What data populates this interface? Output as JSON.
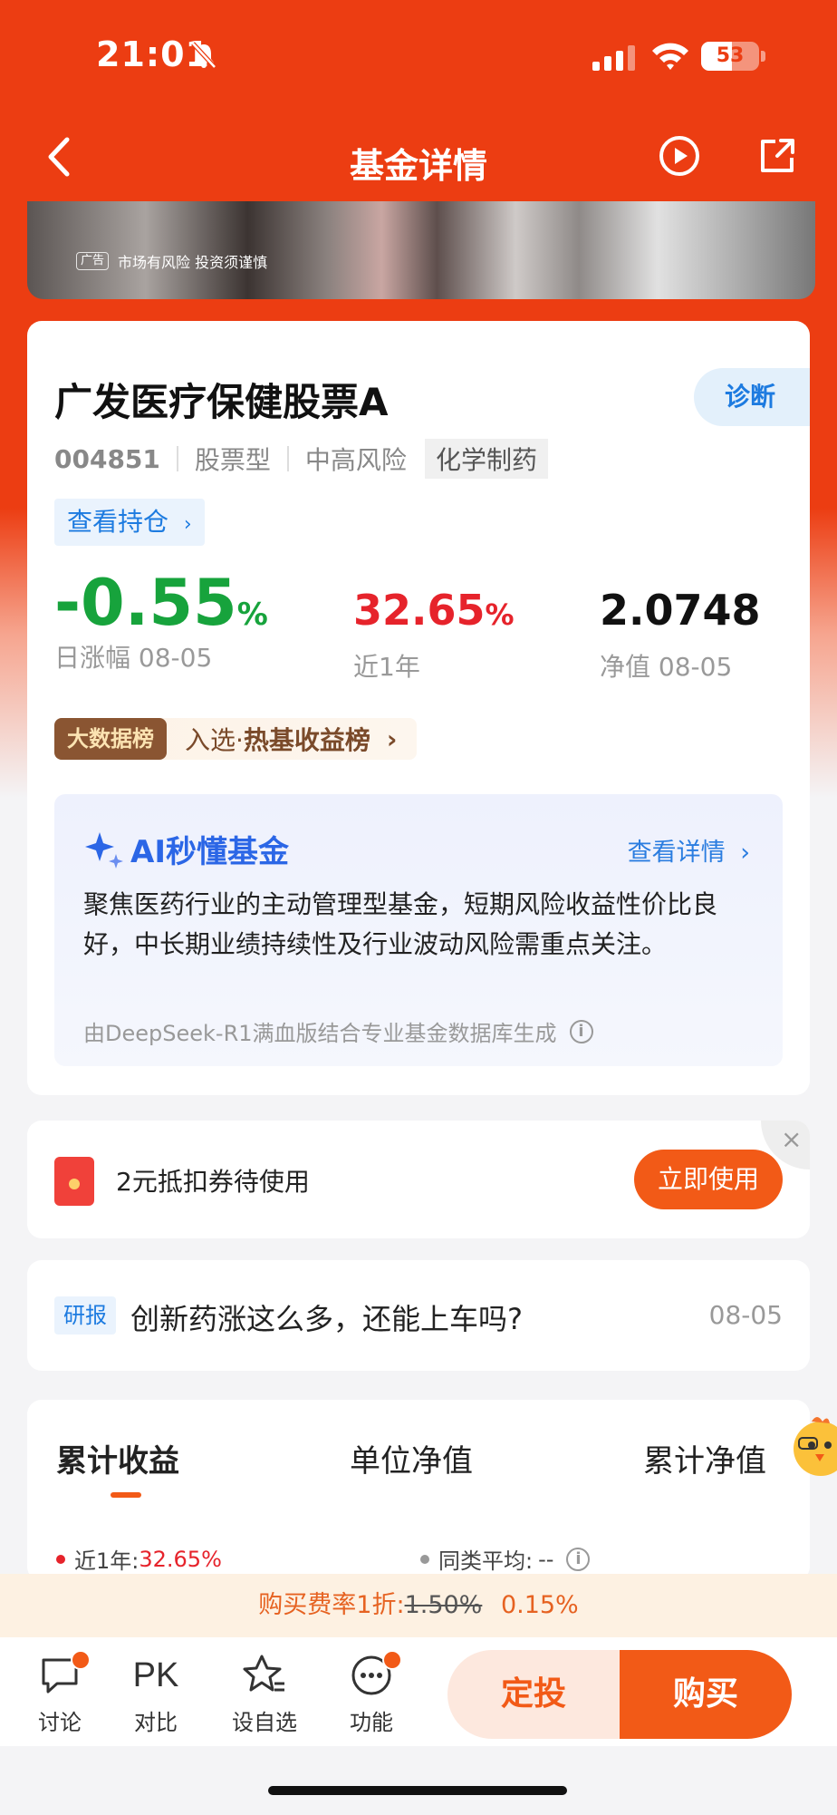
{
  "status": {
    "time": "21:01",
    "battery": "53",
    "battery_level": 0.53
  },
  "nav": {
    "title": "基金详情"
  },
  "ad": {
    "tag": "广告",
    "text": "市场有风险 投资须谨慎"
  },
  "fund": {
    "name": "广发医疗保健股票A",
    "diagnose_label": "诊断",
    "code": "004851",
    "type": "股票型",
    "risk": "中高风险",
    "sector_tag": "化学制药",
    "holdings_label": "查看持仓",
    "daily_change": "-0.55",
    "daily_change_unit": "%",
    "daily_change_label": "日涨幅 08-05",
    "one_year": "32.65",
    "one_year_unit": "%",
    "one_year_label": "近1年",
    "nav_value": "2.0748",
    "nav_label": "净值 08-05",
    "rank_badge": "大数据榜",
    "rank_prefix": "入选·",
    "rank_name": "热基收益榜"
  },
  "ai": {
    "title": "AI秒懂基金",
    "more": "查看详情",
    "body": "聚焦医药行业的主动管理型基金，短期风险收益性价比良好，中长期业绩持续性及行业波动风险需重点关注。",
    "footer": "由DeepSeek-R1满血版结合专业基金数据库生成"
  },
  "coupon": {
    "label": "2元抵扣券待使用",
    "button": "立即使用"
  },
  "report": {
    "tag": "研报",
    "title": "创新药涨这么多，还能上车吗?",
    "date": "08-05"
  },
  "tabs": {
    "items": [
      "累计收益",
      "单位净值",
      "累计净值"
    ],
    "legend_1y_label": "近1年:",
    "legend_1y_value": "32.65%",
    "legend_avg_label": "同类平均:",
    "legend_avg_value": "--"
  },
  "fee": {
    "prefix": "购买费率1折:",
    "old": "1.50%",
    "new": "0.15%"
  },
  "bottom": {
    "discuss": "讨论",
    "compare": "对比",
    "compare_icon_text": "PK",
    "favorite": "设自选",
    "functions": "功能",
    "sip": "定投",
    "buy": "购买"
  },
  "colors": {
    "brand": "#ec3d12",
    "accent": "#f25a17",
    "down": "#17a33c",
    "up": "#e6232b",
    "link": "#1d7be0"
  }
}
